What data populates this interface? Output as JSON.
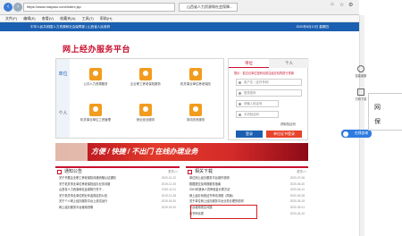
{
  "browser": {
    "address": "https://www.mayssz.com/index.jsp",
    "tab_label": "山西省人力资源和社会保障...",
    "menu": [
      "文件(F)",
      "编辑(E)",
      "查看(V)",
      "收藏夹(A)",
      "工具(T)",
      "帮助(H)"
    ]
  },
  "site": {
    "topbar_left": "中华人民共和国人力资源和社会保障部  |  山西省人民政府",
    "topbar_right": "2020年8月10日 星期四",
    "brand": "网上经办服务平台"
  },
  "services": {
    "left_tab_1": "单位",
    "left_tab_2": "个人",
    "items": [
      {
        "label": "公共人力资源服务"
      },
      {
        "label": "企业职工养老保险服务"
      },
      {
        "label": "机关事业单位养老保险"
      },
      {
        "label": "机关事业单位工资管理"
      },
      {
        "label": "就业创业服务"
      },
      {
        "label": "劳动关系服务"
      }
    ]
  },
  "login": {
    "tab_unit": "单位",
    "tab_person": "个人",
    "notice": "提示：若忘记单位密码请前往经办机构进行重置",
    "username_placeholder": "用户名（证件号码）",
    "password_placeholder": "登录密码",
    "code_placeholder": "请输入验证码",
    "sms_placeholder": "手机验证码",
    "captcha_text": "获取验证码",
    "login_button": "登录",
    "register_button": "单位证书登录"
  },
  "rail": {
    "item1": "智能客服",
    "item2": "扫码下载",
    "online": "在线咨询"
  },
  "banner": {
    "text": "方便 / 快捷 / 不出门  在线办理业务"
  },
  "notices": {
    "title": "通知公告",
    "more": "更多>>",
    "rows": [
      {
        "title": "关于开展企业职工养老保险待遇资格认证通知",
        "date": "2020-01-22"
      },
      {
        "title": "关于机关事业单位养老保险经办业务问题",
        "date": "2019-12-25"
      },
      {
        "title": "山西省人力资源和社会保障厅关于...",
        "date": "2019-11-01"
      },
      {
        "title": "关于机关事业单位职业年金核定的公告",
        "date": "2019-10-28"
      },
      {
        "title": "关于个人网上经办服务平台上线试运行",
        "date": "2019-09-30"
      },
      {
        "title": "网上经办服务平台使用说明",
        "date": "2019-09-20"
      }
    ]
  },
  "downloads": {
    "title": "相关下载",
    "more": "更多>>",
    "rows": [
      {
        "title": "单位网上经办服务平台操作说明",
        "date": "2020-07-06"
      },
      {
        "title": "数据提交及申报服务指南",
        "date": "2020-06-30"
      },
      {
        "title": "2021年退休人员养老金计算方法",
        "date": "2020-06-12"
      },
      {
        "title": "网上经办系统证书申请流程（简版）",
        "date": "2020-05-28"
      },
      {
        "title": "关于单位网上经办服务平台业务办理的说明",
        "date": "2020-05-15"
      },
      {
        "title": "平台使用常见问题",
        "date": "2020-05-01"
      },
      {
        "title": "证书申请表",
        "date": "2020-04-20"
      }
    ]
  },
  "popup": {
    "line1": "网",
    "line2": "保"
  }
}
